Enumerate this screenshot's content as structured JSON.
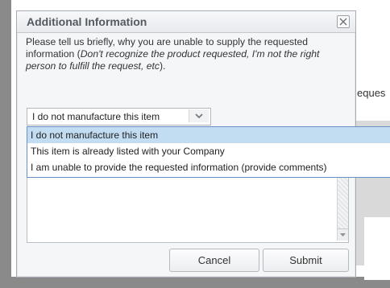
{
  "background": {
    "partial_text": "eques"
  },
  "dialog": {
    "title": "Additional Information",
    "instructions_plain": "Please tell us briefly, why you are unable to supply the requested information (",
    "instructions_italic": "Don't recognize the product requested, I'm not the right person to fulfill the request, etc",
    "instructions_end": ").",
    "select": {
      "value": "I do not manufacture this item"
    },
    "dropdown_options": [
      "I do not manufacture this item",
      "This item is already listed with your Company",
      "I am unable to provide the requested information (provide comments)"
    ],
    "buttons": {
      "cancel": "Cancel",
      "submit": "Submit"
    }
  },
  "icons": {
    "close": "close-icon",
    "dropdown_arrow": "chevron-down-icon",
    "scroll_down": "scroll-down-arrow-icon"
  },
  "colors": {
    "selected_option": "#c2dcf2",
    "dropdown_border": "#6a8fc4"
  }
}
